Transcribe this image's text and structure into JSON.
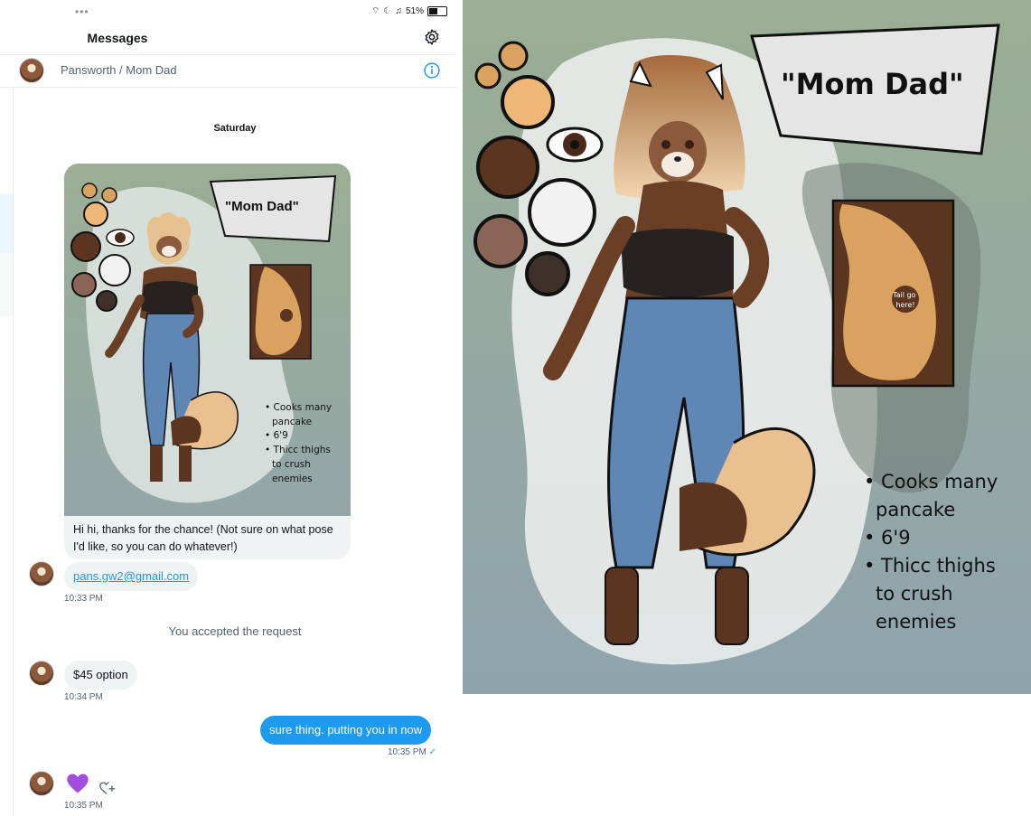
{
  "status_bar": {
    "dots": "•••",
    "battery": "51%",
    "battery_level": 0.51
  },
  "header": {
    "title": "Messages"
  },
  "conversation": {
    "name": "Pansworth / Mom Dad"
  },
  "day_label": "Saturday",
  "messages": [
    {
      "type": "incoming-image",
      "caption": "Hi hi, thanks for the chance! (Not sure on what pose I'd like, so you can do whatever!)"
    },
    {
      "type": "incoming",
      "text": "pans.gw2@gmail.com",
      "time": "10:33 PM"
    },
    {
      "type": "system",
      "text": "You accepted the request"
    },
    {
      "type": "incoming",
      "text": "$45 option",
      "time": "10:34 PM"
    },
    {
      "type": "outgoing",
      "text": "sure thing. putting you in now",
      "time": "10:35 PM",
      "read_mark": "✓"
    },
    {
      "type": "incoming-emoji",
      "emoji": "purple-heart",
      "time": "10:35 PM"
    }
  ],
  "artwork": {
    "title": "\"Mom Dad\"",
    "tail_note": [
      "Tail go",
      "here!"
    ],
    "notes": [
      "• Cooks many",
      "pancake",
      "• 6'9",
      "• Thicc thighs",
      "to crush",
      "enemies"
    ],
    "palette": [
      "#d9a35f",
      "#f0b877",
      "#5c3521",
      "#f2f2f2",
      "#8a6556",
      "#3e312a"
    ],
    "background": "#8fa3a1"
  },
  "colors": {
    "accent": "#1d9bf0",
    "bubble_in": "#eff3f4",
    "heart": "#a24de0"
  }
}
